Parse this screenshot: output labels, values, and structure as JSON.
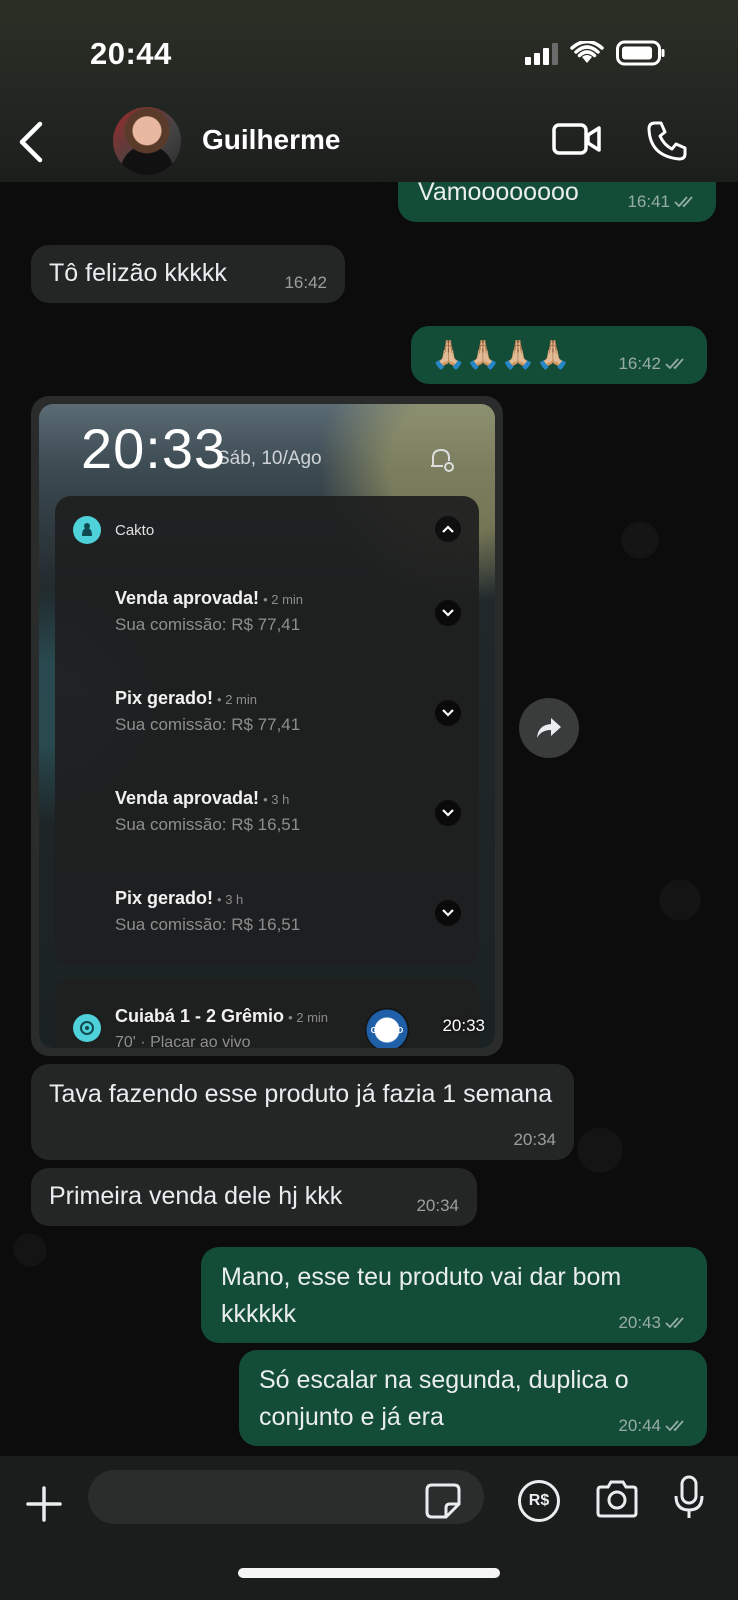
{
  "status_bar": {
    "time": "20:44"
  },
  "header": {
    "contact_name": "Guilherme"
  },
  "messages": [
    {
      "id": "m1",
      "direction": "out",
      "text": "Vamoooooooo",
      "time": "16:41",
      "read": true
    },
    {
      "id": "m2",
      "direction": "in",
      "text": "Tô felizão kkkkk",
      "time": "16:42"
    },
    {
      "id": "m3",
      "direction": "out",
      "text": "🙏🏼🙏🏼🙏🏼🙏🏼",
      "time": "16:42",
      "read": true
    },
    {
      "id": "m5",
      "direction": "in",
      "text": "Tava fazendo esse produto já fazia 1 semana",
      "time": "20:34"
    },
    {
      "id": "m6",
      "direction": "in",
      "text": "Primeira venda dele hj kkk",
      "time": "20:34"
    },
    {
      "id": "m7",
      "direction": "out",
      "text": "Mano, esse teu produto vai dar bom kkkkkk",
      "time": "20:43",
      "read": true
    },
    {
      "id": "m8",
      "direction": "out",
      "text": "Só escalar na segunda, duplica o conjunto e já era",
      "time": "20:44",
      "read": true
    }
  ],
  "image_message": {
    "lock_time": "20:33",
    "lock_date": "Sáb, 10/Ago",
    "app_name": "Cakto",
    "notifications": [
      {
        "title": "Venda aprovada!",
        "age": "• 2 min",
        "body": "Sua comissão: R$ 77,41"
      },
      {
        "title": "Pix gerado!",
        "age": "• 2 min",
        "body": "Sua comissão: R$ 77,41"
      },
      {
        "title": "Venda aprovada!",
        "age": "• 3 h",
        "body": "Sua comissão: R$ 16,51"
      },
      {
        "title": "Pix gerado!",
        "age": "• 3 h",
        "body": "Sua comissão: R$ 16,51"
      }
    ],
    "match": {
      "title": "Cuiabá 1 - 2 Grêmio",
      "age": "• 2 min",
      "sub": "70' · Placar ao vivo",
      "badge": "GRÊMIO"
    },
    "media_time": "20:33"
  },
  "input_bar": {
    "pay_label": "R$"
  },
  "colors": {
    "incoming": "#242626",
    "outgoing": "#144d37",
    "header": "#232722"
  },
  "icons": [
    "back-arrow-icon",
    "video-call-icon",
    "phone-icon",
    "forward-icon",
    "plus-icon",
    "sticker-icon",
    "camera-icon",
    "mic-icon",
    "read-ticks-icon"
  ]
}
